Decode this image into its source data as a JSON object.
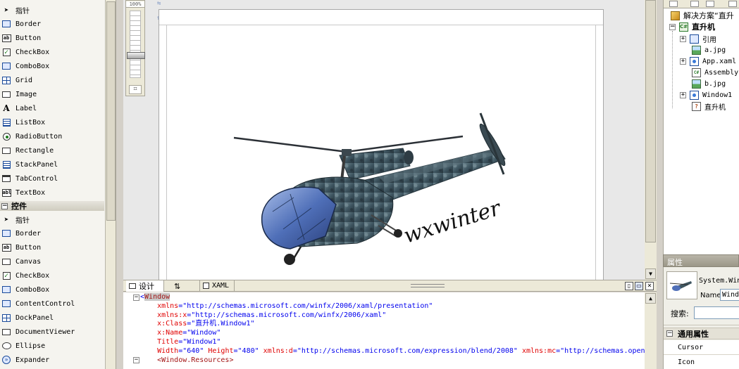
{
  "toolbox": {
    "group1_items": [
      {
        "label": "指针",
        "icon": "pointer-arrow-icon"
      },
      {
        "label": "Border",
        "icon": "border-icon"
      },
      {
        "label": "Button",
        "icon": "button-icon"
      },
      {
        "label": "CheckBox",
        "icon": "checkbox-icon"
      },
      {
        "label": "ComboBox",
        "icon": "combobox-icon"
      },
      {
        "label": "Grid",
        "icon": "grid-icon"
      },
      {
        "label": "Image",
        "icon": "image-icon"
      },
      {
        "label": "Label",
        "icon": "label-icon"
      },
      {
        "label": "ListBox",
        "icon": "listbox-icon"
      },
      {
        "label": "RadioButton",
        "icon": "radiobutton-icon"
      },
      {
        "label": "Rectangle",
        "icon": "rectangle-icon"
      },
      {
        "label": "StackPanel",
        "icon": "stackpanel-icon"
      },
      {
        "label": "TabControl",
        "icon": "tabcontrol-icon"
      },
      {
        "label": "TextBox",
        "icon": "textbox-icon"
      }
    ],
    "group2_header": "控件",
    "group2_items": [
      {
        "label": "指针",
        "icon": "pointer-arrow-icon"
      },
      {
        "label": "Border",
        "icon": "border-icon"
      },
      {
        "label": "Button",
        "icon": "button-icon"
      },
      {
        "label": "Canvas",
        "icon": "canvas-icon"
      },
      {
        "label": "CheckBox",
        "icon": "checkbox-icon"
      },
      {
        "label": "ComboBox",
        "icon": "combobox-icon"
      },
      {
        "label": "ContentControl",
        "icon": "contentcontrol-icon"
      },
      {
        "label": "DockPanel",
        "icon": "dockpanel-icon"
      },
      {
        "label": "DocumentViewer",
        "icon": "documentviewer-icon"
      },
      {
        "label": "Ellipse",
        "icon": "ellipse-icon"
      },
      {
        "label": "Expander",
        "icon": "expander-icon"
      }
    ]
  },
  "designer": {
    "zoom_label": "100%",
    "canvas_text": "wxwinter",
    "image_subject": "helicopter-3d-model"
  },
  "tabs": {
    "design_label": "设计",
    "swap_label": "⇅",
    "xaml_label": "XAML"
  },
  "xaml": {
    "lines": [
      {
        "kind": "tag",
        "text": "Window"
      },
      {
        "kind": "attr",
        "attr": "xmlns",
        "value": "\"http://schemas.microsoft.com/winfx/2006/xaml/presentation\""
      },
      {
        "kind": "attr",
        "attr": "xmlns:x",
        "value": "\"http://schemas.microsoft.com/winfx/2006/xaml\""
      },
      {
        "kind": "attr",
        "attr": "x:Class",
        "value": "\"直升机.Window1\""
      },
      {
        "kind": "attr",
        "attr": "x:Name",
        "value": "\"Window\""
      },
      {
        "kind": "attr",
        "attr": "Title",
        "value": "\"Window1\""
      },
      {
        "kind": "multi",
        "parts": [
          {
            "attr": "Width",
            "value": "\"640\""
          },
          {
            "attr": " Height",
            "value": "\"480\""
          },
          {
            "attr": " xmlns:d",
            "value": "\"http://schemas.microsoft.com/expression/blend/2008\""
          },
          {
            "attr": " xmlns:mc",
            "value": "\"http://schemas.openx"
          }
        ]
      },
      {
        "kind": "tagline",
        "text": "<Window.Resources>"
      }
    ]
  },
  "solution": {
    "root_label": "解决方案“直升",
    "project_label": "直升机",
    "items": [
      {
        "label": "引用",
        "icon": "references-icon",
        "expandable": true
      },
      {
        "label": "a.jpg",
        "icon": "image-file-icon",
        "expandable": false
      },
      {
        "label": "App.xaml",
        "icon": "xaml-file-icon",
        "expandable": true
      },
      {
        "label": "AssemblyInfo",
        "icon": "assembly-info-icon",
        "expandable": false
      },
      {
        "label": "b.jpg",
        "icon": "image-file-icon",
        "expandable": false
      },
      {
        "label": "Window1",
        "icon": "xaml-file-icon",
        "expandable": true
      },
      {
        "label": "直升机",
        "icon": "settings-file-icon",
        "expandable": false
      }
    ]
  },
  "properties": {
    "title": "属性",
    "type_name": "System.Windows",
    "name_label": "Name:",
    "name_value": "Window",
    "search_label": "搜索:",
    "search_value": "",
    "category_label": "通用属性",
    "rows": [
      "Cursor",
      "Icon"
    ]
  }
}
